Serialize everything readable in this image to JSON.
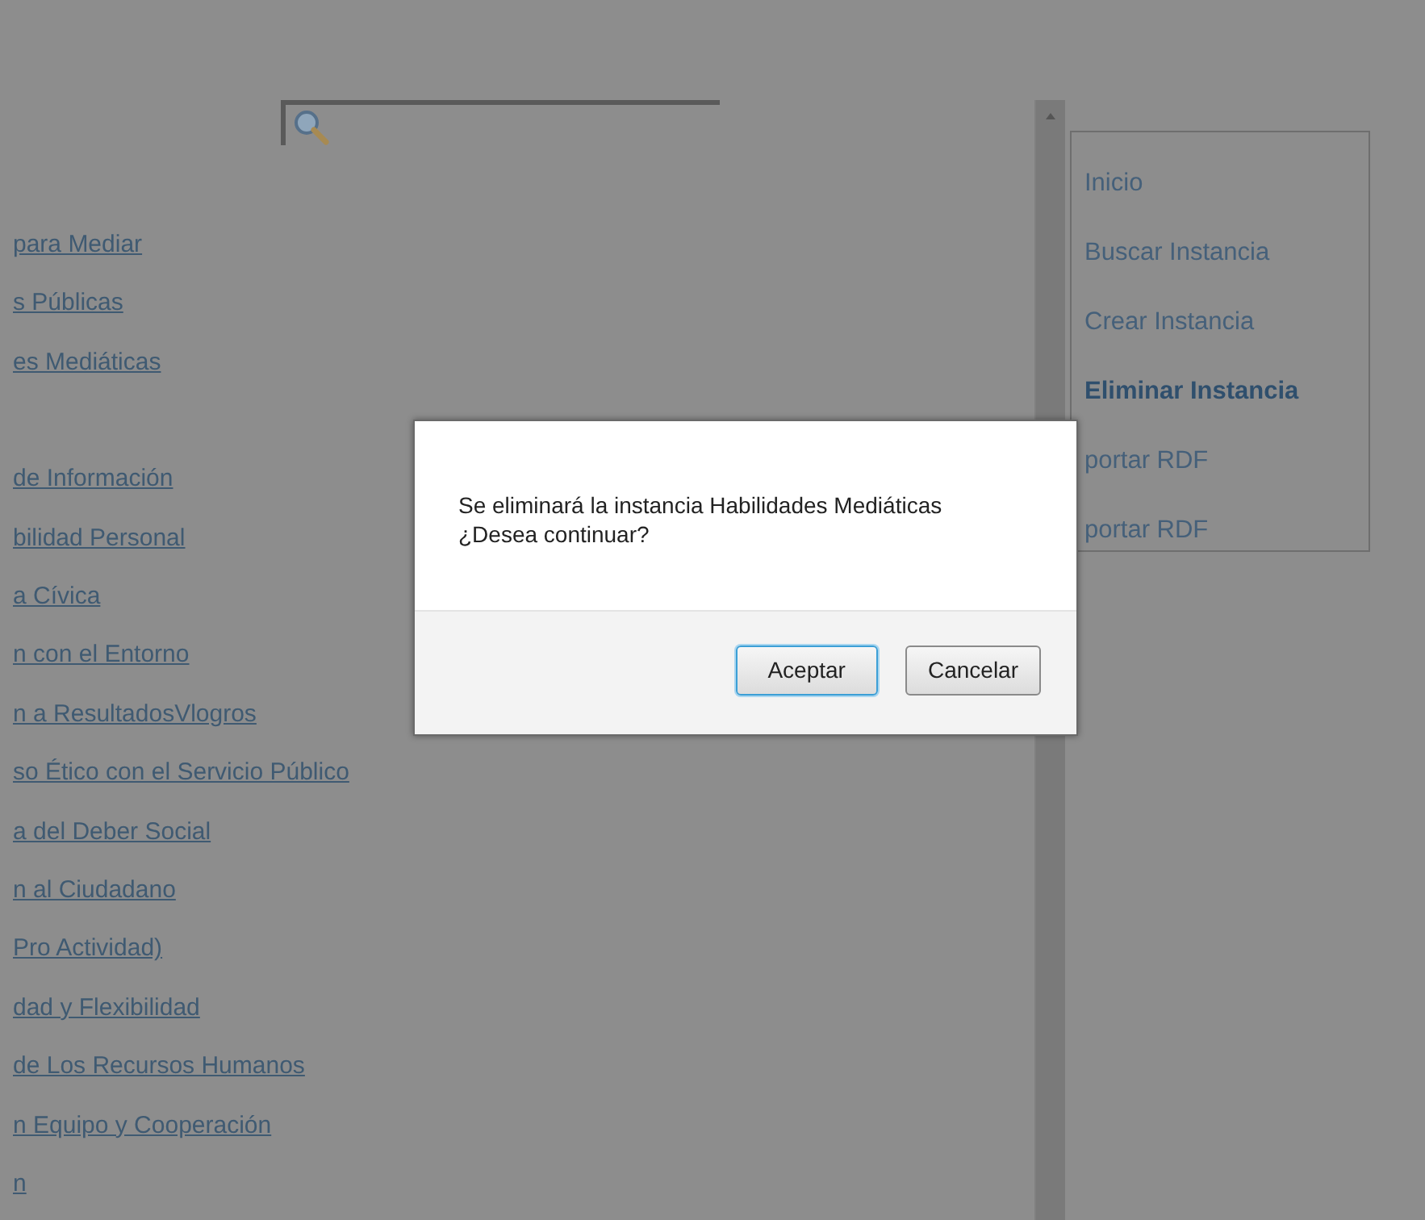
{
  "link_groups": [
    [
      {
        "label": "para Mediar"
      },
      {
        "label": "s Públicas"
      },
      {
        "label": "es Mediáticas"
      }
    ],
    [
      {
        "label": "de Información"
      },
      {
        "label": "bilidad Personal"
      },
      {
        "label": "a Cívica"
      },
      {
        "label": "n con el Entorno"
      },
      {
        "label": "n a ResultadosVlogros"
      },
      {
        "label": "so Ético con el Servicio Público"
      },
      {
        "label": "a del Deber Social"
      },
      {
        "label": "n al Ciudadano"
      },
      {
        "label": "Pro Actividad)"
      },
      {
        "label": "dad y Flexibilidad"
      },
      {
        "label": "de Los Recursos Humanos"
      },
      {
        "label": "n Equipo y Cooperación"
      },
      {
        "label": "n"
      }
    ]
  ],
  "menu": [
    {
      "label": "Inicio",
      "selected": false
    },
    {
      "label": "Buscar Instancia",
      "selected": false
    },
    {
      "label": "Crear Instancia",
      "selected": false
    },
    {
      "label": "Eliminar Instancia",
      "selected": true
    },
    {
      "label": "portar RDF",
      "selected": false
    },
    {
      "label": "portar RDF",
      "selected": false
    }
  ],
  "dialog": {
    "message": "Se eliminará la instancia Habilidades Mediáticas",
    "question": "¿Desea continuar?",
    "buttons": [
      {
        "label": "Aceptar",
        "focused": true
      },
      {
        "label": "Cancelar",
        "focused": false
      }
    ]
  }
}
